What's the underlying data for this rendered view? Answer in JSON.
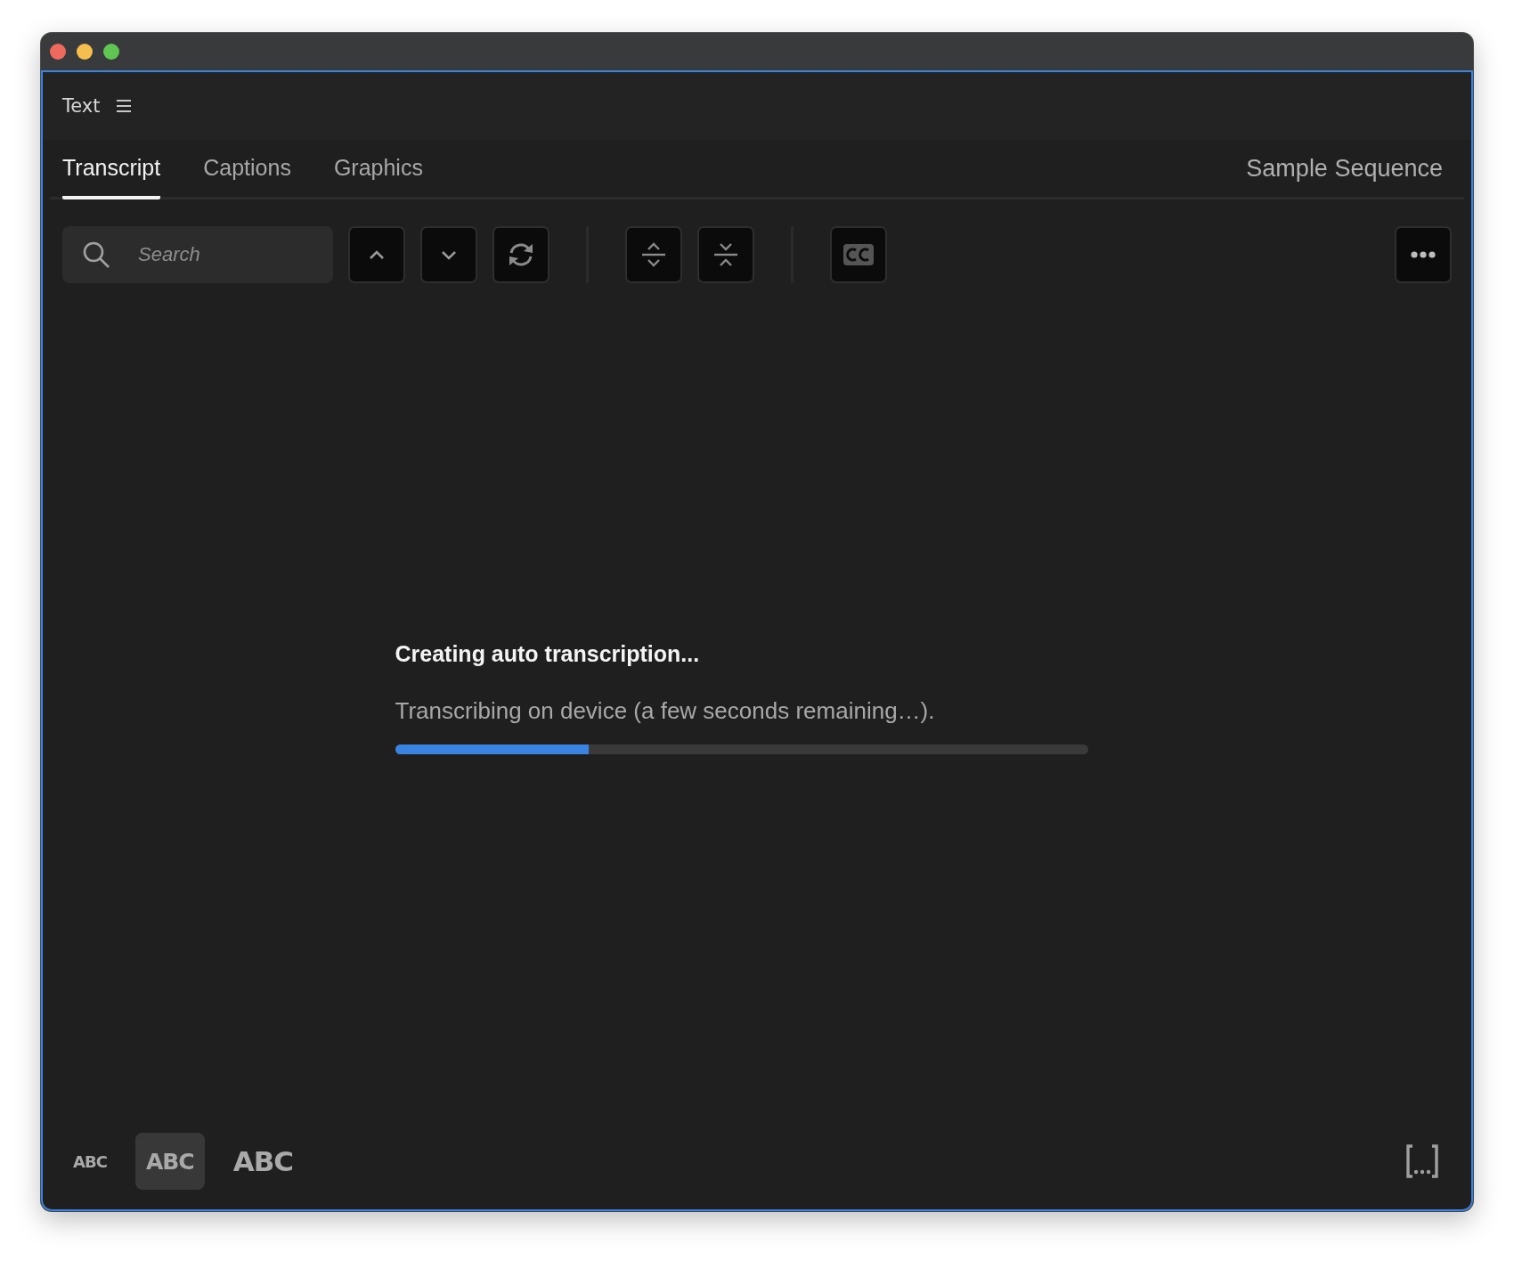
{
  "panel": {
    "title": "Text"
  },
  "tabs": [
    {
      "label": "Transcript",
      "selected": true
    },
    {
      "label": "Captions",
      "selected": false
    },
    {
      "label": "Graphics",
      "selected": false
    }
  ],
  "sequence": "Sample Sequence",
  "search": {
    "placeholder": "Search"
  },
  "toolbar": [
    {
      "kind": "up"
    },
    {
      "kind": "down"
    },
    {
      "kind": "refresh"
    },
    {
      "kind": "separator"
    },
    {
      "kind": "expand"
    },
    {
      "kind": "collapse"
    },
    {
      "kind": "separator"
    },
    {
      "kind": "captions"
    },
    {
      "kind": "spacer"
    },
    {
      "kind": "more"
    }
  ],
  "status": {
    "title": "Creating auto transcription...",
    "message": "Transcribing on device (a few seconds remaining…).",
    "level": 0.28
  },
  "text_sizes": [
    {
      "label": "ABC",
      "kind": "small",
      "selected": false
    },
    {
      "label": "ABC",
      "kind": "medium",
      "selected": true
    },
    {
      "label": "ABC",
      "kind": "large",
      "selected": false
    }
  ]
}
